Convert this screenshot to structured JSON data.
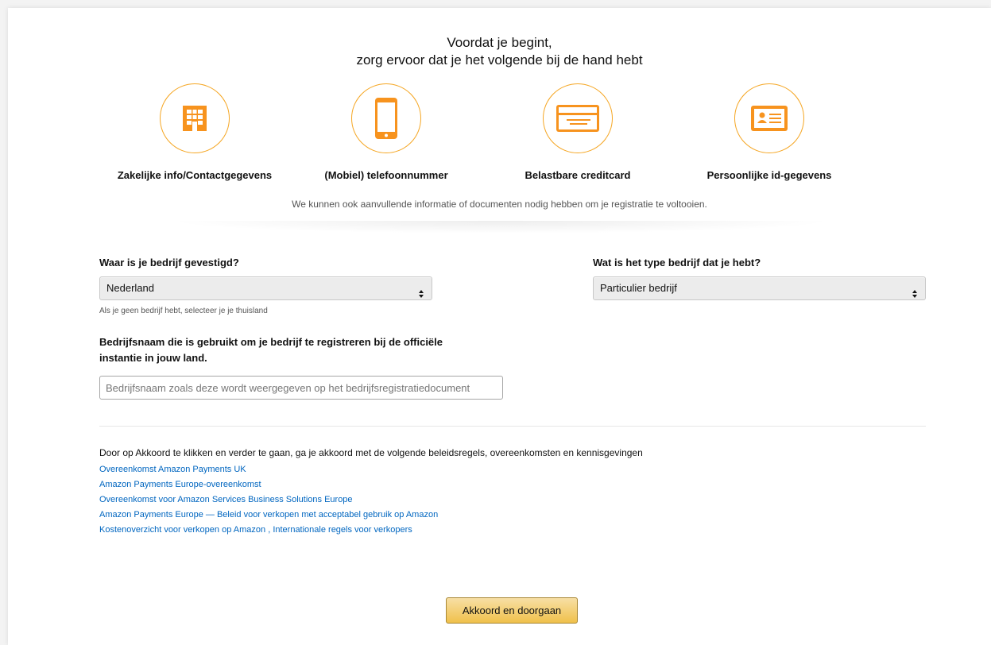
{
  "intro": {
    "line1": "Voordat je begint,",
    "line2": "zorg ervoor dat je het volgende bij de hand hebt"
  },
  "requirements": [
    {
      "label": "Zakelijke info/Contactgegevens",
      "icon": "building-icon"
    },
    {
      "label": "(Mobiel) telefoonnummer",
      "icon": "mobile-phone-icon"
    },
    {
      "label": "Belastbare creditcard",
      "icon": "credit-card-icon"
    },
    {
      "label": "Persoonlijke id-gegevens",
      "icon": "id-card-icon"
    }
  ],
  "note": "We kunnen ook aanvullende informatie of documenten nodig hebben om je registratie te voltooien.",
  "form": {
    "country_label": "Waar is je bedrijf gevestigd?",
    "country_value": "Nederland",
    "country_hint": "Als je geen bedrijf hebt, selecteer je je thuisland",
    "business_type_label": "Wat is het type bedrijf dat je hebt?",
    "business_type_value": "Particulier bedrijf",
    "company_name_label_line1": "Bedrijfsnaam die is gebruikt om je bedrijf te registreren bij de officiële",
    "company_name_label_line2": "instantie in jouw land.",
    "company_name_placeholder": "Bedrijfsnaam zoals deze wordt weergegeven op het bedrijfsregistratiedocument"
  },
  "legal": {
    "intro": "Door op Akkoord te klikken en verder te gaan, ga je akkoord met de volgende beleidsregels, overeenkomsten en kennisgevingen",
    "links": [
      "Overeenkomst Amazon Payments UK",
      "Amazon Payments Europe-overeenkomst",
      "Overeenkomst voor Amazon Services Business Solutions Europe",
      "Amazon Payments Europe — Beleid voor verkopen met acceptabel gebruik op Amazon"
    ],
    "last_link_a": "Kostenoverzicht voor verkopen op Amazon",
    "separator": ",",
    "last_link_b": "Internationale regels voor verkopers"
  },
  "submit_label": "Akkoord en doorgaan",
  "colors": {
    "accent": "#f5a623",
    "icon_orange": "#f7931e",
    "link": "#0066c0",
    "button_top": "#f7dfa5",
    "button_bottom": "#f0c14b"
  }
}
